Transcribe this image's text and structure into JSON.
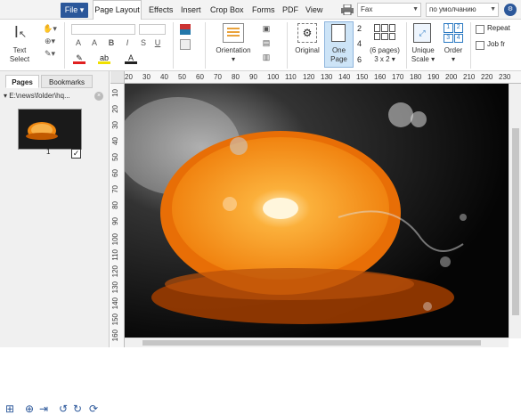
{
  "menu": {
    "file": "File",
    "items": [
      "Page Layout",
      "Effects",
      "Insert",
      "Crop Box",
      "Forms",
      "PDF",
      "View"
    ],
    "printer_combo": "Fax",
    "default_combo": "по умолчанию"
  },
  "ribbon": {
    "text_select": "Text Select",
    "orientation": "Orientation",
    "original": "Original",
    "one_page_1": "One",
    "one_page_2": "Page",
    "nums": [
      "2",
      "4",
      "6"
    ],
    "pages_label_1": "(6 pages)",
    "pages_label_2": "3 x 2",
    "unique_scale_1": "Unique",
    "unique_scale_2": "Scale",
    "order": "Order",
    "order_nums": [
      "1",
      "2",
      "3",
      "4"
    ],
    "repeat": "Repeat",
    "job_from": "Job fr",
    "font_letters": [
      "A",
      "A",
      "B",
      "I",
      "S",
      "U",
      "A"
    ]
  },
  "left_panel": {
    "tabs": [
      "Pages",
      "Bookmarks"
    ],
    "path": "E:\\news\\folder\\hq...",
    "page_number": "1"
  },
  "ruler": {
    "h": [
      "20",
      "30",
      "40",
      "50",
      "60",
      "70",
      "80",
      "90",
      "100",
      "110",
      "120",
      "130",
      "140",
      "150",
      "160",
      "170",
      "180",
      "190",
      "200",
      "210",
      "220",
      "230"
    ],
    "v": [
      "10",
      "20",
      "30",
      "40",
      "50",
      "60",
      "70",
      "80",
      "90",
      "100",
      "110",
      "120",
      "130",
      "140",
      "150",
      "160"
    ]
  },
  "colors": {
    "file_bg": "#2b579a",
    "accent": "#2b579a",
    "orange": "#f28a12"
  }
}
